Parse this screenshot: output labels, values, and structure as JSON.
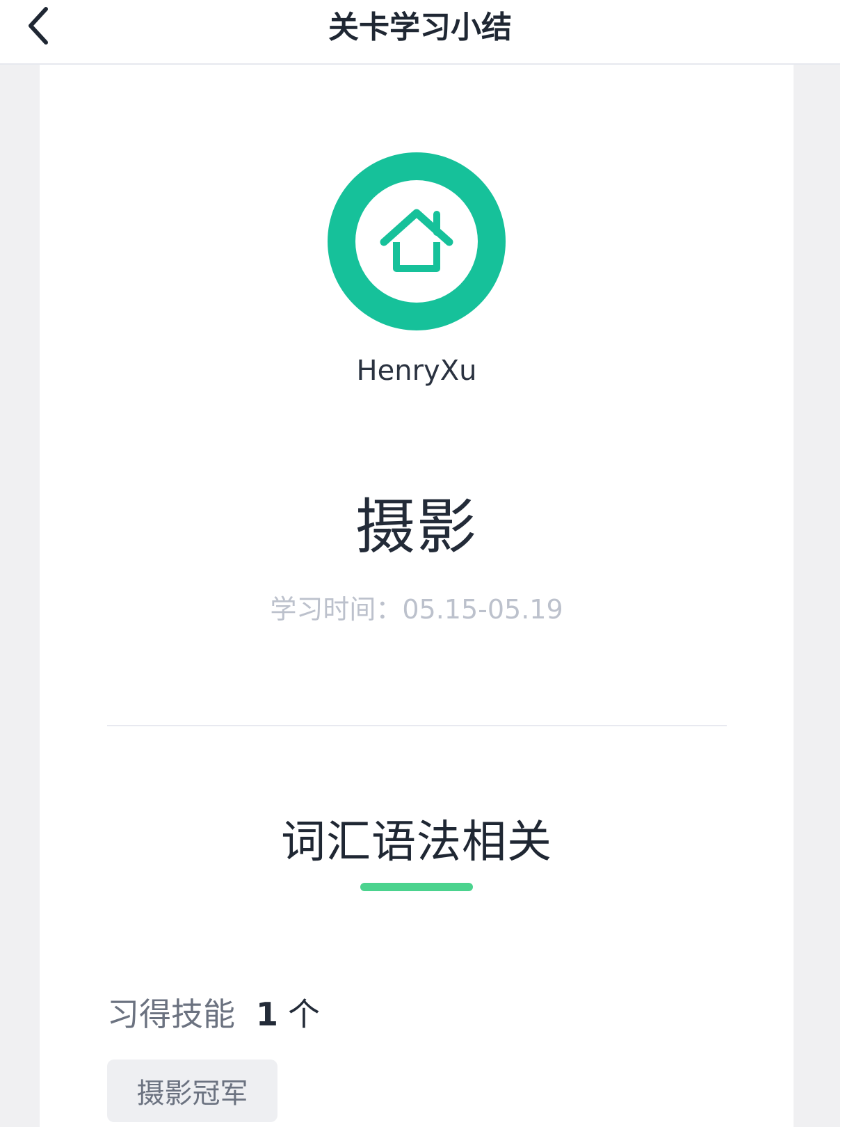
{
  "header": {
    "title": "关卡学习小结",
    "back_icon": "chevron-left-icon"
  },
  "profile": {
    "avatar_icon": "house-icon",
    "avatar_color": "#16c19a",
    "name": "HenryXu"
  },
  "course": {
    "title": "摄影",
    "study_time": "学习时间：05.15-05.19"
  },
  "section": {
    "title": "词汇语法相关",
    "accent_color": "#4bd38e"
  },
  "skills": {
    "label": "习得技能",
    "count": "1",
    "unit": "个",
    "items": [
      "摄影冠军"
    ]
  }
}
